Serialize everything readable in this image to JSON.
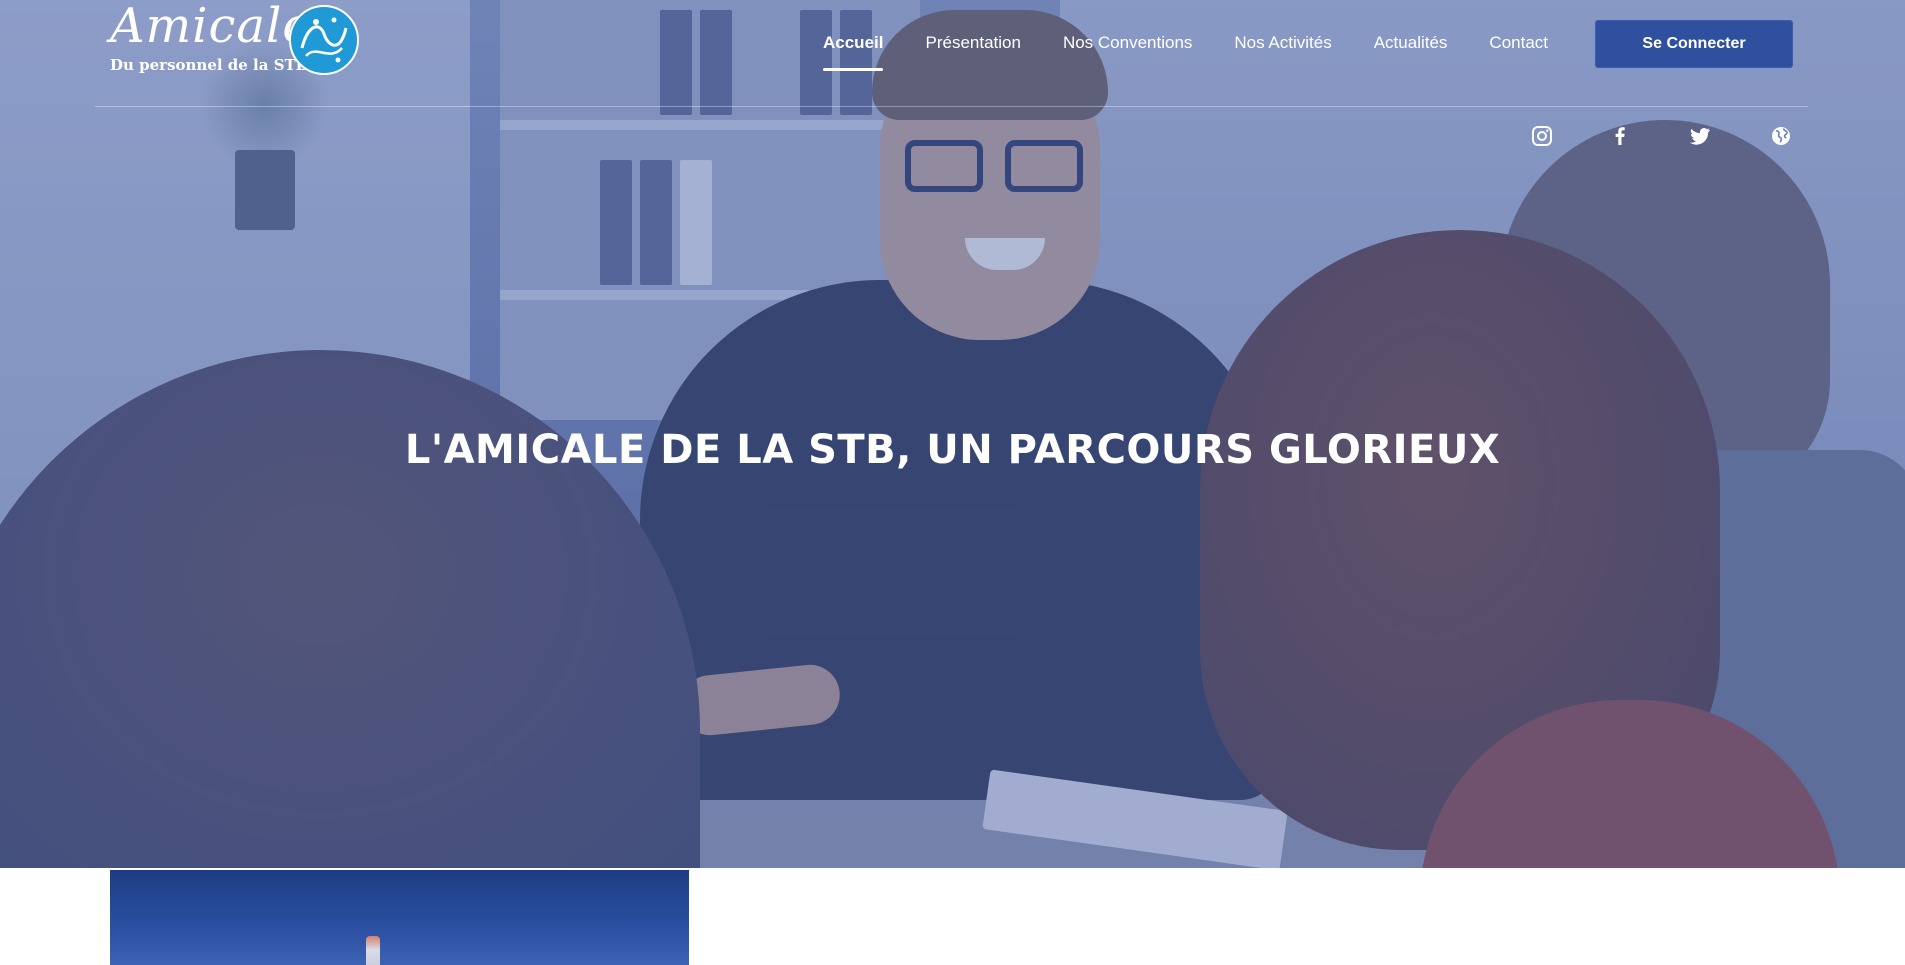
{
  "brand": {
    "logo_script": "Amicale",
    "logo_subtitle": "Du personnel de la STB",
    "emblem_icon": "stb-arabic-calligraphy-emblem",
    "accent_color": "#2f4f9f"
  },
  "nav": {
    "items": [
      {
        "label": "Accueil",
        "active": true
      },
      {
        "label": "Présentation",
        "active": false
      },
      {
        "label": "Nos Conventions",
        "active": false
      },
      {
        "label": "Nos Activités",
        "active": false
      },
      {
        "label": "Actualités",
        "active": false
      },
      {
        "label": "Contact",
        "active": false
      }
    ],
    "login_label": "Se Connecter"
  },
  "socials": [
    {
      "icon": "instagram-icon"
    },
    {
      "icon": "facebook-icon"
    },
    {
      "icon": "twitter-icon"
    },
    {
      "icon": "globe-icon"
    }
  ],
  "hero": {
    "title": "L'AMICALE DE LA STB, UN PARCOURS GLORIEUX",
    "overlay_color": "#465fa5"
  }
}
